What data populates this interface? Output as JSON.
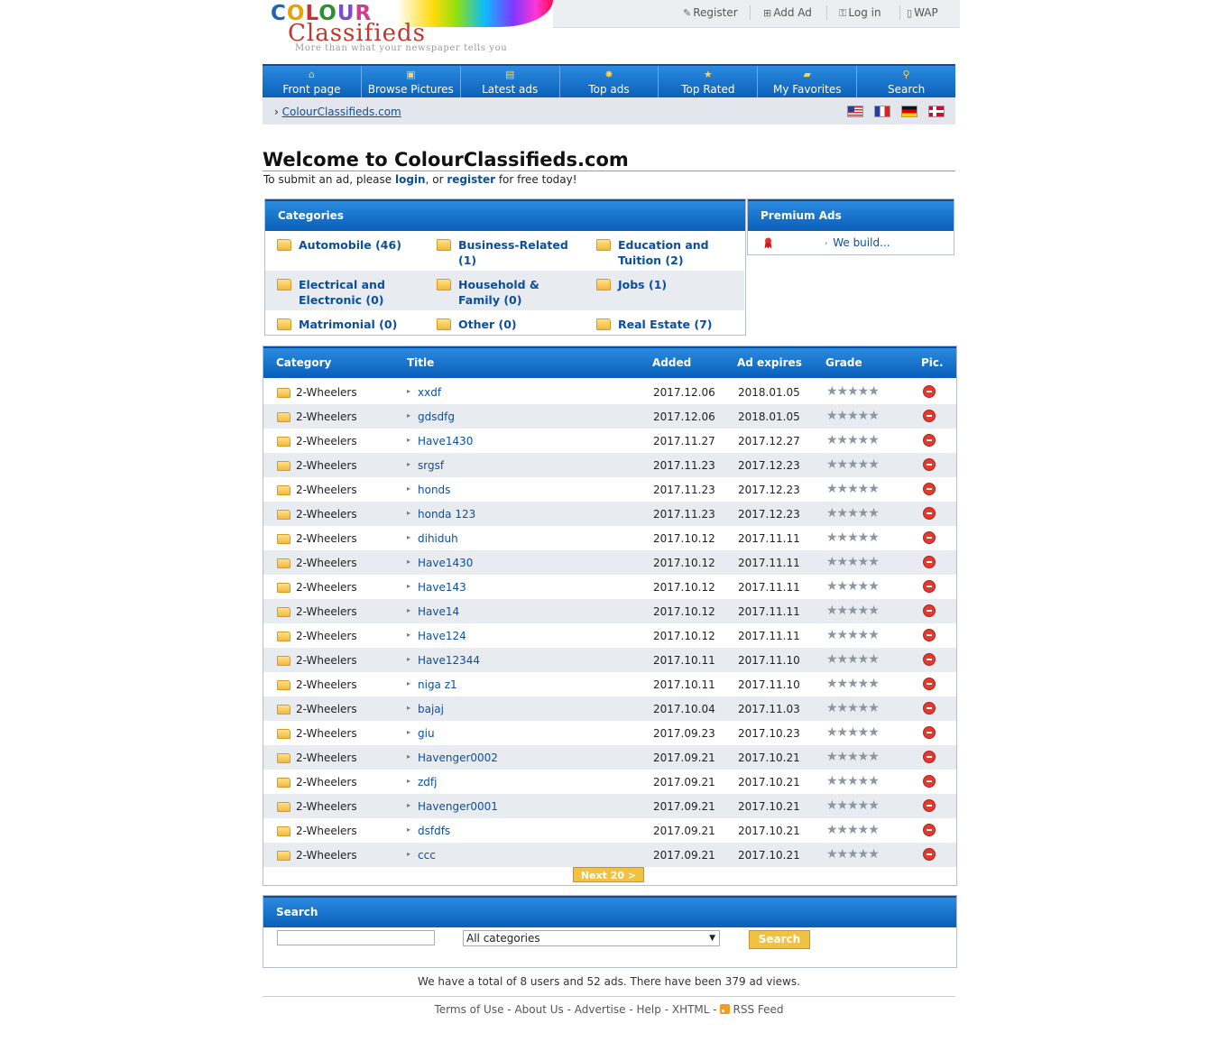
{
  "header": {
    "logo_word1": [
      "C",
      "O",
      "L",
      "O",
      "U",
      "R"
    ],
    "logo_word2": "Classifieds",
    "logo_tagline": "More than what your newspaper tells you",
    "links": [
      {
        "label": "Register",
        "icon": "pencil-icon"
      },
      {
        "label": "Add Ad",
        "icon": "add-ad-icon"
      },
      {
        "label": "Log in",
        "icon": "key-icon"
      },
      {
        "label": "WAP",
        "icon": "mobile-icon"
      }
    ]
  },
  "nav": [
    {
      "label": "Front page",
      "icon": "home-icon",
      "glyph": "⌂"
    },
    {
      "label": "Browse Pictures",
      "icon": "pictures-icon",
      "glyph": "▣"
    },
    {
      "label": "Latest ads",
      "icon": "latest-ads-icon",
      "glyph": "▤"
    },
    {
      "label": "Top ads",
      "icon": "top-ads-icon",
      "glyph": "✸"
    },
    {
      "label": "Top Rated",
      "icon": "star-icon",
      "glyph": "★"
    },
    {
      "label": "My Favorites",
      "icon": "favorites-icon",
      "glyph": "▰"
    },
    {
      "label": "Search",
      "icon": "search-icon",
      "glyph": "⚲"
    }
  ],
  "breadcrumb": {
    "arrow": "›",
    "link": "ColourClassifieds.com"
  },
  "flags": [
    "us-flag-icon",
    "fr-flag-icon",
    "de-flag-icon",
    "no-flag-icon"
  ],
  "welcome": {
    "title": "Welcome to ColourClassifieds.com",
    "pre": "To submit an ad, please ",
    "login": "login",
    "mid": ", or ",
    "register": "register",
    "post": " for free today!"
  },
  "categories": {
    "title": "Categories",
    "items": [
      "Automobile (46)",
      "Business-Related (1)",
      "Education and Tuition (2)",
      "Electrical and Electronic (0)",
      "Household & Family (0)",
      "Jobs (1)",
      "Matrimonial (0)",
      "Other (0)",
      "Real Estate (7)"
    ]
  },
  "premium": {
    "title": "Premium Ads",
    "item": "We build..."
  },
  "ads_table": {
    "headers": {
      "category": "Category",
      "title": "Title",
      "added": "Added",
      "expires": "Ad expires",
      "grade": "Grade",
      "pic": "Pic."
    },
    "rows": [
      {
        "category": "2-Wheelers",
        "title": "xxdf",
        "added": "2017.12.06",
        "expires": "2018.01.05"
      },
      {
        "category": "2-Wheelers",
        "title": "gdsdfg",
        "added": "2017.12.06",
        "expires": "2018.01.05"
      },
      {
        "category": "2-Wheelers",
        "title": "Have1430",
        "added": "2017.11.27",
        "expires": "2017.12.27"
      },
      {
        "category": "2-Wheelers",
        "title": "srgsf",
        "added": "2017.11.23",
        "expires": "2017.12.23"
      },
      {
        "category": "2-Wheelers",
        "title": "honds",
        "added": "2017.11.23",
        "expires": "2017.12.23"
      },
      {
        "category": "2-Wheelers",
        "title": "honda 123",
        "added": "2017.11.23",
        "expires": "2017.12.23"
      },
      {
        "category": "2-Wheelers",
        "title": "dihiduh",
        "added": "2017.10.12",
        "expires": "2017.11.11"
      },
      {
        "category": "2-Wheelers",
        "title": "Have1430",
        "added": "2017.10.12",
        "expires": "2017.11.11"
      },
      {
        "category": "2-Wheelers",
        "title": "Have143",
        "added": "2017.10.12",
        "expires": "2017.11.11"
      },
      {
        "category": "2-Wheelers",
        "title": "Have14",
        "added": "2017.10.12",
        "expires": "2017.11.11"
      },
      {
        "category": "2-Wheelers",
        "title": "Have124",
        "added": "2017.10.12",
        "expires": "2017.11.11"
      },
      {
        "category": "2-Wheelers",
        "title": "Have12344",
        "added": "2017.10.11",
        "expires": "2017.11.10"
      },
      {
        "category": "2-Wheelers",
        "title": "niga z1",
        "added": "2017.10.11",
        "expires": "2017.11.10"
      },
      {
        "category": "2-Wheelers",
        "title": "bajaj",
        "added": "2017.10.04",
        "expires": "2017.11.03"
      },
      {
        "category": "2-Wheelers",
        "title": "giu",
        "added": "2017.09.23",
        "expires": "2017.10.23"
      },
      {
        "category": "2-Wheelers",
        "title": "Havenger0002",
        "added": "2017.09.21",
        "expires": "2017.10.21"
      },
      {
        "category": "2-Wheelers",
        "title": "zdfj",
        "added": "2017.09.21",
        "expires": "2017.10.21"
      },
      {
        "category": "2-Wheelers",
        "title": "Havenger0001",
        "added": "2017.09.21",
        "expires": "2017.10.21"
      },
      {
        "category": "2-Wheelers",
        "title": "dsfdfs",
        "added": "2017.09.21",
        "expires": "2017.10.21"
      },
      {
        "category": "2-Wheelers",
        "title": "ccc",
        "added": "2017.09.21",
        "expires": "2017.10.21"
      }
    ],
    "grade_stars": "★★★★★",
    "next": "Next 20 >"
  },
  "search": {
    "title": "Search",
    "input_value": "",
    "select_value": "All categories",
    "button": "Search"
  },
  "stats": "We have a total of 8 users and 52 ads. There have been 379 ad views.",
  "footer": {
    "links": [
      "Terms of Use",
      "About Us",
      "Advertise",
      "Help",
      "XHTML",
      "RSS Feed"
    ],
    "sep": "-"
  },
  "colors": {
    "nav_blue": "#0a5eb7",
    "link": "#0b4f9c",
    "button_yellow": "#f3c141",
    "row_alt": "#e8ebf0"
  }
}
